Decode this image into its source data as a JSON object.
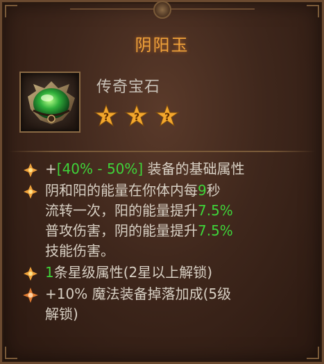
{
  "item": {
    "name": "阴阳玉",
    "type": "传奇宝石",
    "icon": "green-gem-icon",
    "socket_count": 3,
    "socket_symbol": "?"
  },
  "stats": [
    {
      "prefix": "+",
      "green": "[40% - 50%]",
      "rest": " 装备的基础属性"
    },
    {
      "lines": [
        [
          "阴和阳的能量在你体内每",
          "9",
          "秒"
        ],
        [
          "流转一次，阳的能量提升",
          "7.5%",
          ""
        ],
        [
          "普攻伤害，阴的能量提升",
          "7.5%",
          ""
        ],
        [
          "技能伤害。",
          "",
          ""
        ]
      ]
    },
    {
      "green": "1",
      "rest": "条星级属性(2星以上解锁)"
    },
    {
      "prefix": "+10% ",
      "rest": "魔法装备掉落加成(5级",
      "rest2": "解锁)"
    }
  ],
  "colors": {
    "title": "#f0a23a",
    "highlight": "#3fd43a",
    "text": "#d8d0c4"
  }
}
